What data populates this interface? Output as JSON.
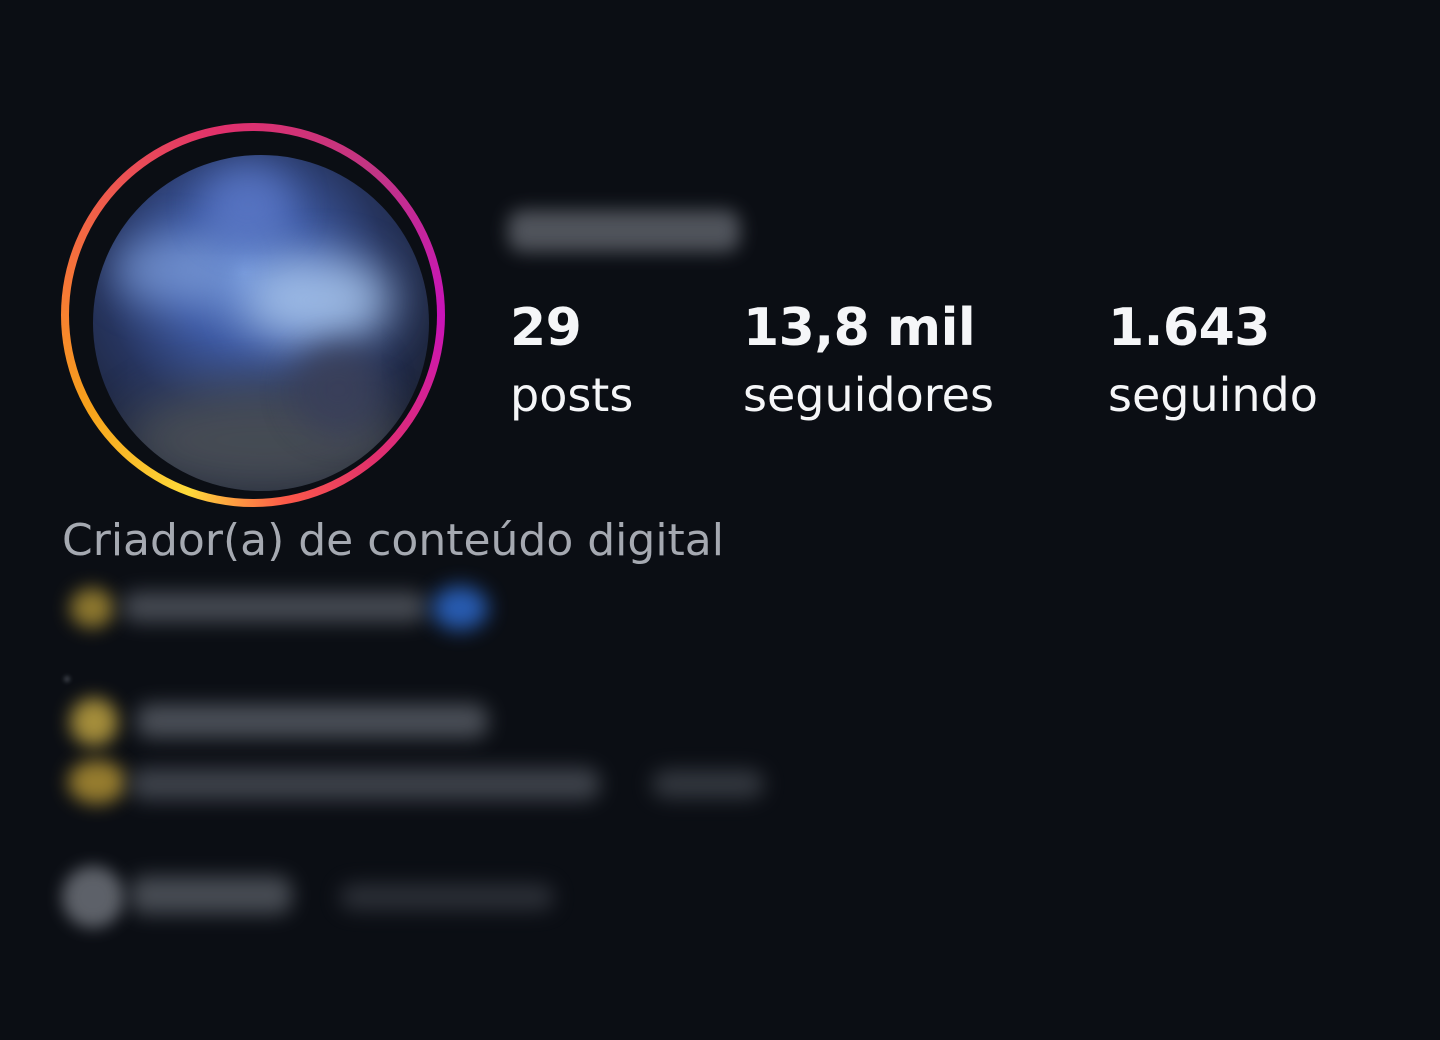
{
  "profile": {
    "stats": {
      "posts": {
        "count": "29",
        "label": "posts"
      },
      "followers": {
        "count": "13,8 mil",
        "label": "seguidores"
      },
      "following": {
        "count": "1.643",
        "label": "seguindo"
      }
    },
    "category": "Criador(a) de conteúdo digital"
  },
  "colors": {
    "background": "#0b0e14",
    "text_primary": "#f5f6f8",
    "text_secondary": "#a5a9b1",
    "story_ring": [
      "#feda3a",
      "#f77737",
      "#e1306c",
      "#c13584"
    ]
  }
}
